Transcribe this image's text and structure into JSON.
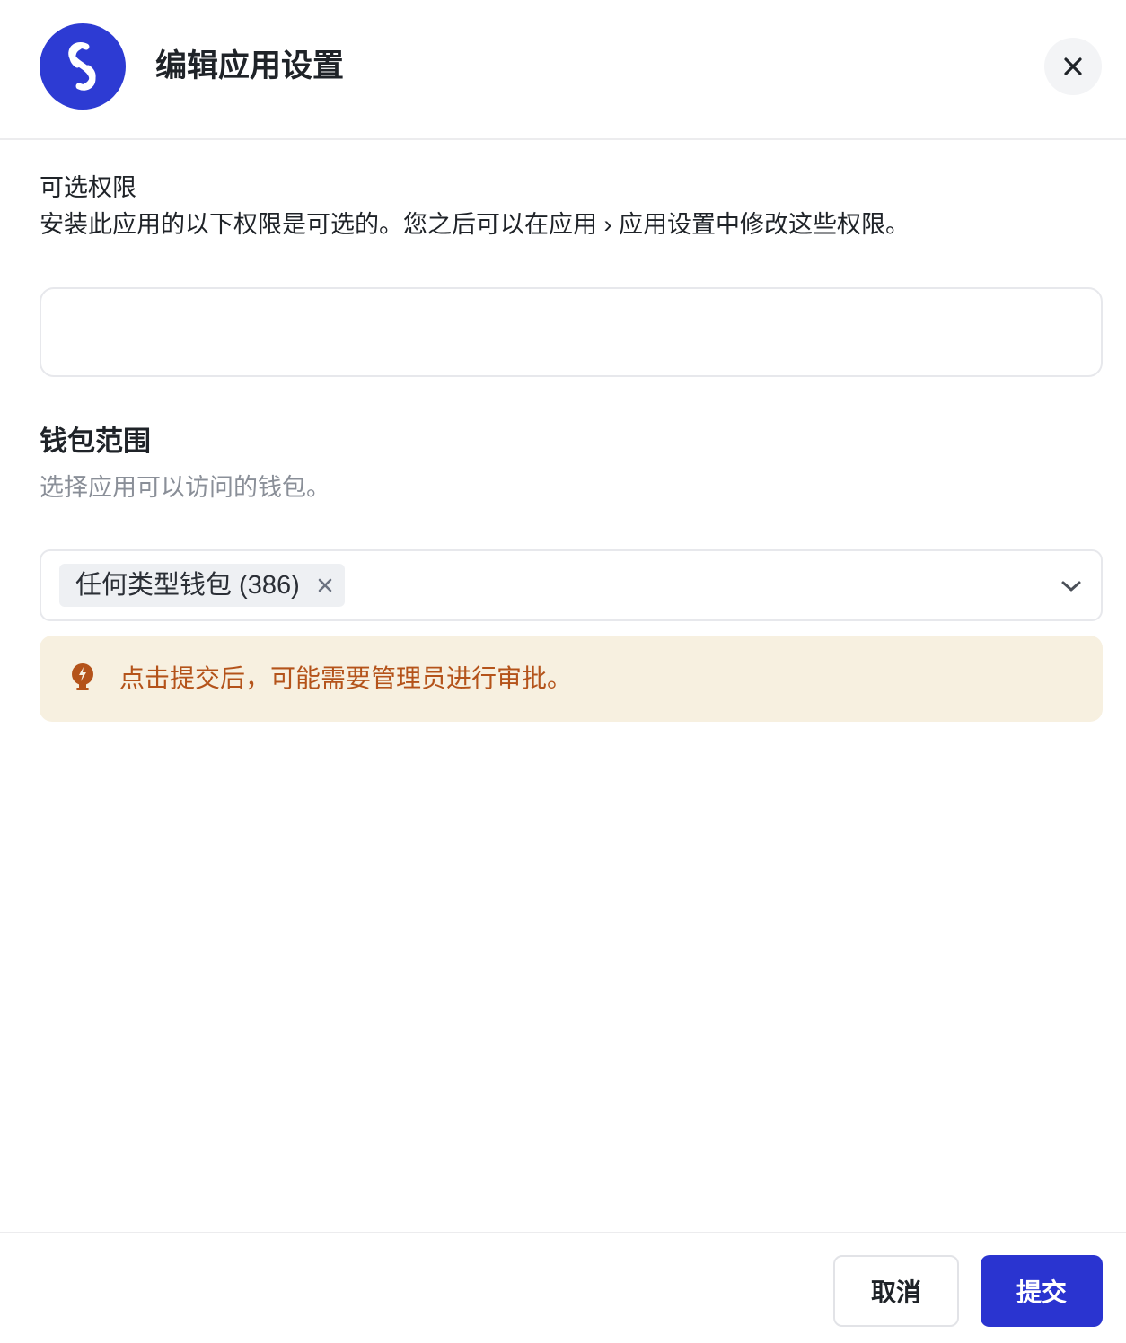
{
  "header": {
    "logo_icon": "link-icon",
    "title": "编辑应用设置",
    "close_icon": "close-icon"
  },
  "optional_permissions": {
    "title": "可选权限",
    "description": "安装此应用的以下权限是可选的。您之后可以在应用 › 应用设置中修改这些权限。"
  },
  "wallet_scope": {
    "title": "钱包范围",
    "description": "选择应用可以访问的钱包。",
    "selected": [
      {
        "label": "任何类型钱包 (386)",
        "remove_icon": "close-icon"
      }
    ],
    "dropdown_icon": "chevron-down-icon"
  },
  "notice": {
    "icon": "lightbulb-icon",
    "text": "点击提交后，可能需要管理员进行审批。",
    "color": "#b4531a",
    "background": "#f7f0e0"
  },
  "footer": {
    "cancel_label": "取消",
    "submit_label": "提交"
  },
  "colors": {
    "brand": "#2d3bd3",
    "primary_button": "#2a34d0"
  }
}
